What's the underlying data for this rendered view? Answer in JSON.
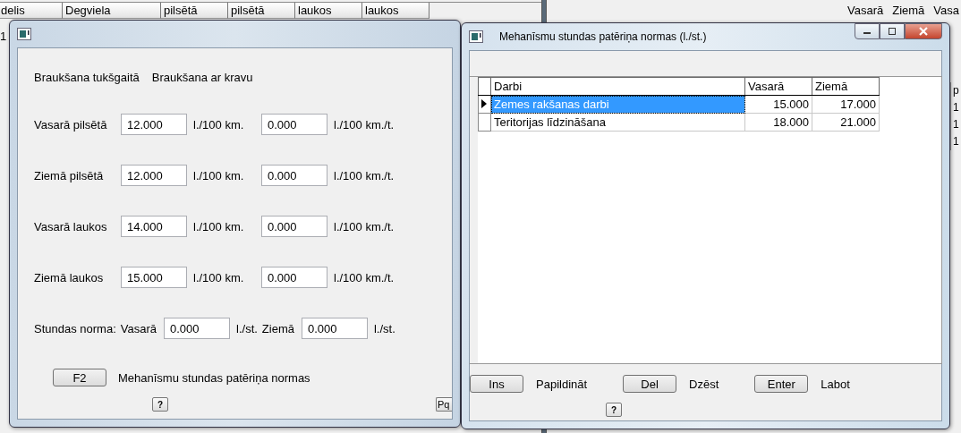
{
  "back_window_left": {
    "columns": [
      "delis",
      "Degviela",
      "pilsētā",
      "pilsētā",
      "laukos",
      "laukos"
    ],
    "row_marker": "1"
  },
  "back_window_right": {
    "columns": [
      "Vasarā",
      "Ziemā",
      "Vasa"
    ],
    "side_header": "p",
    "side_cells": [
      "1",
      "1",
      "1"
    ]
  },
  "fuel_dialog": {
    "headers": [
      "Braukšana tukšgaitā",
      "Braukšana ar kravu"
    ],
    "rows": [
      {
        "label": "Vasarā pilsētā",
        "empty_value": "12.000",
        "empty_unit": "l./100 km.",
        "load_value": "0.000",
        "load_unit": "l./100 km./t."
      },
      {
        "label": "Ziemā pilsētā",
        "empty_value": "12.000",
        "empty_unit": "l./100 km.",
        "load_value": "0.000",
        "load_unit": "l./100 km./t."
      },
      {
        "label": "Vasarā laukos",
        "empty_value": "14.000",
        "empty_unit": "l./100 km.",
        "load_value": "0.000",
        "load_unit": "l./100 km./t."
      },
      {
        "label": "Ziemā laukos",
        "empty_value": "15.000",
        "empty_unit": "l./100 km.",
        "load_value": "0.000",
        "load_unit": "l./100 km./t."
      }
    ],
    "hours_norm": {
      "label": "Stundas norma:",
      "summer_label": "Vasarā",
      "summer_value": "0.000",
      "summer_unit": "l./st.",
      "winter_label": "Ziemā",
      "winter_value": "0.000",
      "winter_unit": "l./st."
    },
    "f2_button": "F2",
    "f2_label": "Mehanīsmu stundas patēriņa normas",
    "help_button": "?",
    "cut_button": "Pq"
  },
  "norms_window": {
    "title": "Mehanīsmu stundas patēriņa normas (l./st.)",
    "table": {
      "columns": [
        "Darbi",
        "Vasarā",
        "Ziemā"
      ],
      "rows": [
        {
          "cells": [
            "Zemes rakšanas darbi",
            "15.000",
            "17.000"
          ],
          "selected": true
        },
        {
          "cells": [
            "Teritorijas līdzināšana",
            "18.000",
            "21.000"
          ],
          "selected": false
        }
      ]
    },
    "actions": [
      {
        "key": "Ins",
        "label": "Papildināt"
      },
      {
        "key": "Del",
        "label": "Dzēst"
      },
      {
        "key": "Enter",
        "label": "Labot"
      }
    ],
    "help_button": "?"
  }
}
